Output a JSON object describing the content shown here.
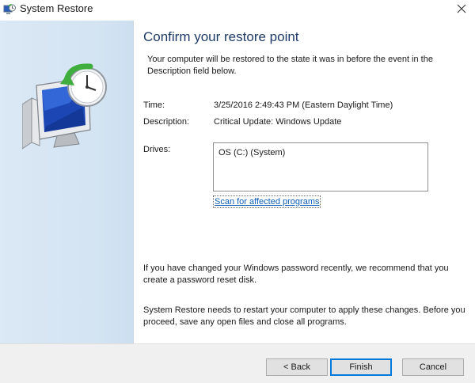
{
  "window": {
    "title": "System Restore",
    "title_icon": "system-restore-icon",
    "close_icon": "close-icon"
  },
  "left_panel": {
    "hero_icon": "system-restore-monitor-clock-icon"
  },
  "content": {
    "heading": "Confirm your restore point",
    "intro": "Your computer will be restored to the state it was in before the event in the Description field below.",
    "time_label": "Time:",
    "time_value": "3/25/2016 2:49:43 PM (Eastern Daylight Time)",
    "description_label": "Description:",
    "description_value": "Critical Update: Windows Update",
    "drives_label": "Drives:",
    "drives": [
      "OS (C:) (System)"
    ],
    "scan_link": "Scan for affected programs",
    "password_note": "If you have changed your Windows password recently, we recommend that you create a password reset disk.",
    "restart_note": "System Restore needs to restart your computer to apply these changes. Before you proceed, save any open files and close all programs."
  },
  "footer": {
    "back_label": "< Back",
    "finish_label": "Finish",
    "cancel_label": "Cancel"
  },
  "colors": {
    "heading": "#1d3a66",
    "link": "#0c5fb8",
    "panel": "#d7e6f4",
    "focus_border": "#0078d7"
  }
}
